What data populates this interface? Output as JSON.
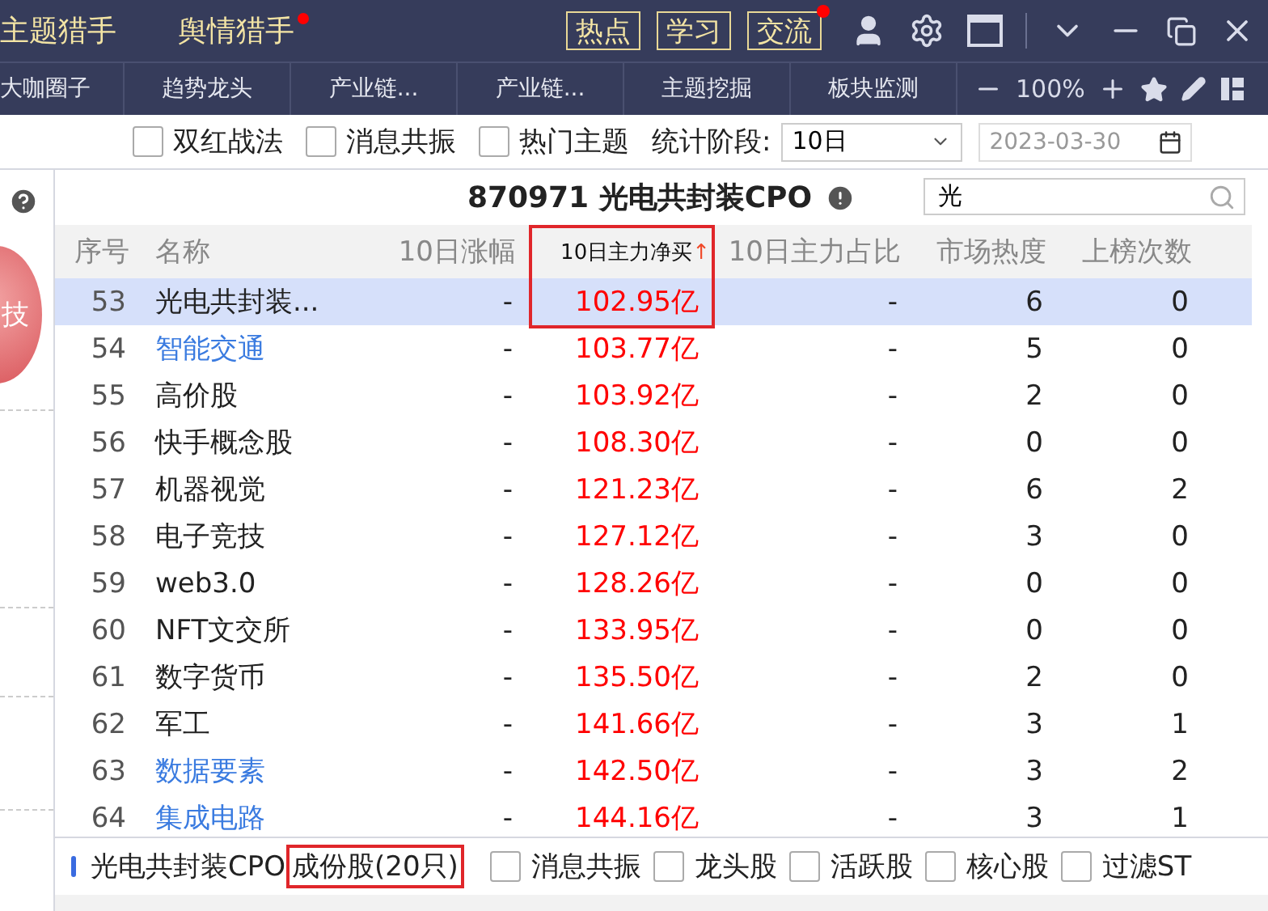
{
  "top_bar": {
    "nav": [
      {
        "label": "主题猎手",
        "dot": false
      },
      {
        "label": "舆情猎手",
        "dot": true
      }
    ],
    "buttons": [
      {
        "label": "热点",
        "dot": false
      },
      {
        "label": "学习",
        "dot": false
      },
      {
        "label": "交流",
        "dot": true
      }
    ]
  },
  "tab_bar": {
    "tabs": [
      "大咖圈子",
      "趋势龙头",
      "产业链...",
      "产业链...",
      "主题挖掘",
      "板块监测"
    ],
    "zoom": "100%"
  },
  "filter_bar": {
    "checks": [
      {
        "label": "双红战法",
        "checked": false
      },
      {
        "label": "消息共振",
        "checked": false
      },
      {
        "label": "热门主题",
        "checked": false
      }
    ],
    "period_label": "统计阶段:",
    "period": "10日",
    "date_placeholder": "2023-03-30"
  },
  "left_panel": {
    "badge": "技"
  },
  "table": {
    "title": "870971 光电共封装CPO",
    "search": "光",
    "columns": [
      {
        "label": "序号",
        "sorted": false
      },
      {
        "label": "名称",
        "sorted": false
      },
      {
        "label": "10日涨幅",
        "sorted": false
      },
      {
        "label": "10日主力净买",
        "sorted": true,
        "sort_arrow": "↑",
        "highlighted": true
      },
      {
        "label": "10日主力占比",
        "sorted": false
      },
      {
        "label": "市场热度",
        "sorted": false
      },
      {
        "label": "上榜次数",
        "sorted": false
      }
    ],
    "rows": [
      {
        "cells": [
          "53",
          "光电共封装...",
          "-",
          "102.95亿",
          "-",
          "6",
          "0"
        ],
        "selected": true,
        "linked": false
      },
      {
        "cells": [
          "54",
          "智能交通",
          "-",
          "103.77亿",
          "-",
          "5",
          "0"
        ],
        "selected": false,
        "linked": true
      },
      {
        "cells": [
          "55",
          "高价股",
          "-",
          "103.92亿",
          "-",
          "2",
          "0"
        ],
        "selected": false,
        "linked": false
      },
      {
        "cells": [
          "56",
          "快手概念股",
          "-",
          "108.30亿",
          "-",
          "0",
          "0"
        ],
        "selected": false,
        "linked": false
      },
      {
        "cells": [
          "57",
          "机器视觉",
          "-",
          "121.23亿",
          "-",
          "6",
          "2"
        ],
        "selected": false,
        "linked": false
      },
      {
        "cells": [
          "58",
          "电子竞技",
          "-",
          "127.12亿",
          "-",
          "3",
          "0"
        ],
        "selected": false,
        "linked": false
      },
      {
        "cells": [
          "59",
          "web3.0",
          "-",
          "128.26亿",
          "-",
          "0",
          "0"
        ],
        "selected": false,
        "linked": false
      },
      {
        "cells": [
          "60",
          "NFT文交所",
          "-",
          "133.95亿",
          "-",
          "0",
          "0"
        ],
        "selected": false,
        "linked": false
      },
      {
        "cells": [
          "61",
          "数字货币",
          "-",
          "135.50亿",
          "-",
          "2",
          "0"
        ],
        "selected": false,
        "linked": false
      },
      {
        "cells": [
          "62",
          "军工",
          "-",
          "141.66亿",
          "-",
          "3",
          "1"
        ],
        "selected": false,
        "linked": false
      },
      {
        "cells": [
          "63",
          "数据要素",
          "-",
          "142.50亿",
          "-",
          "3",
          "2"
        ],
        "selected": false,
        "linked": true
      },
      {
        "cells": [
          "64",
          "集成电路",
          "-",
          "144.16亿",
          "-",
          "3",
          "1"
        ],
        "selected": false,
        "linked": true
      }
    ]
  },
  "bottom_bar": {
    "sector": "光电共封装CPO",
    "members": "成份股(20只)",
    "members_highlighted": true,
    "checks": [
      {
        "label": "消息共振",
        "checked": false
      },
      {
        "label": "龙头股",
        "checked": false
      },
      {
        "label": "活跃股",
        "checked": false
      },
      {
        "label": "核心股",
        "checked": false
      },
      {
        "label": "过滤ST",
        "checked": false
      }
    ]
  }
}
